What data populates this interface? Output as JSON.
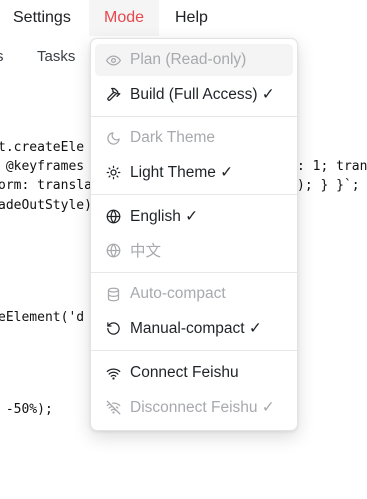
{
  "menubar": {
    "settings": "Settings",
    "mode": "Mode",
    "help": "Help"
  },
  "tabs": {
    "left_fragment": "s",
    "tasks": "Tasks"
  },
  "code_lines": [
    "t.createEle",
    " @keyframes",
    "orm: transla",
    "adeOutStyle)",
    "eElement('d",
    " -50%);",
    ": 1; tran",
    "); } }`;"
  ],
  "menu": {
    "plan": "Plan (Read-only)",
    "build": "Build (Full Access) ✓",
    "dark_theme": "Dark Theme",
    "light_theme": "Light Theme ✓",
    "english": "English ✓",
    "chinese": "中文",
    "auto_compact": "Auto-compact",
    "manual_compact": "Manual-compact ✓",
    "connect_feishu": "Connect Feishu",
    "disconnect_feishu": "Disconnect Feishu ✓"
  },
  "icons": {
    "plan": "eye-icon",
    "build": "hammer-icon",
    "dark": "moon-icon",
    "light": "sun-icon",
    "english": "globe-icon",
    "chinese": "globe-icon",
    "auto": "database-icon",
    "manual": "rotate-ccw-icon",
    "connect": "wifi-icon",
    "disconnect": "wifi-off-icon"
  },
  "colors": {
    "mode_accent": "#e5484d",
    "disabled_text": "#a7a9ad",
    "hover_bg": "#f4f4f5"
  }
}
